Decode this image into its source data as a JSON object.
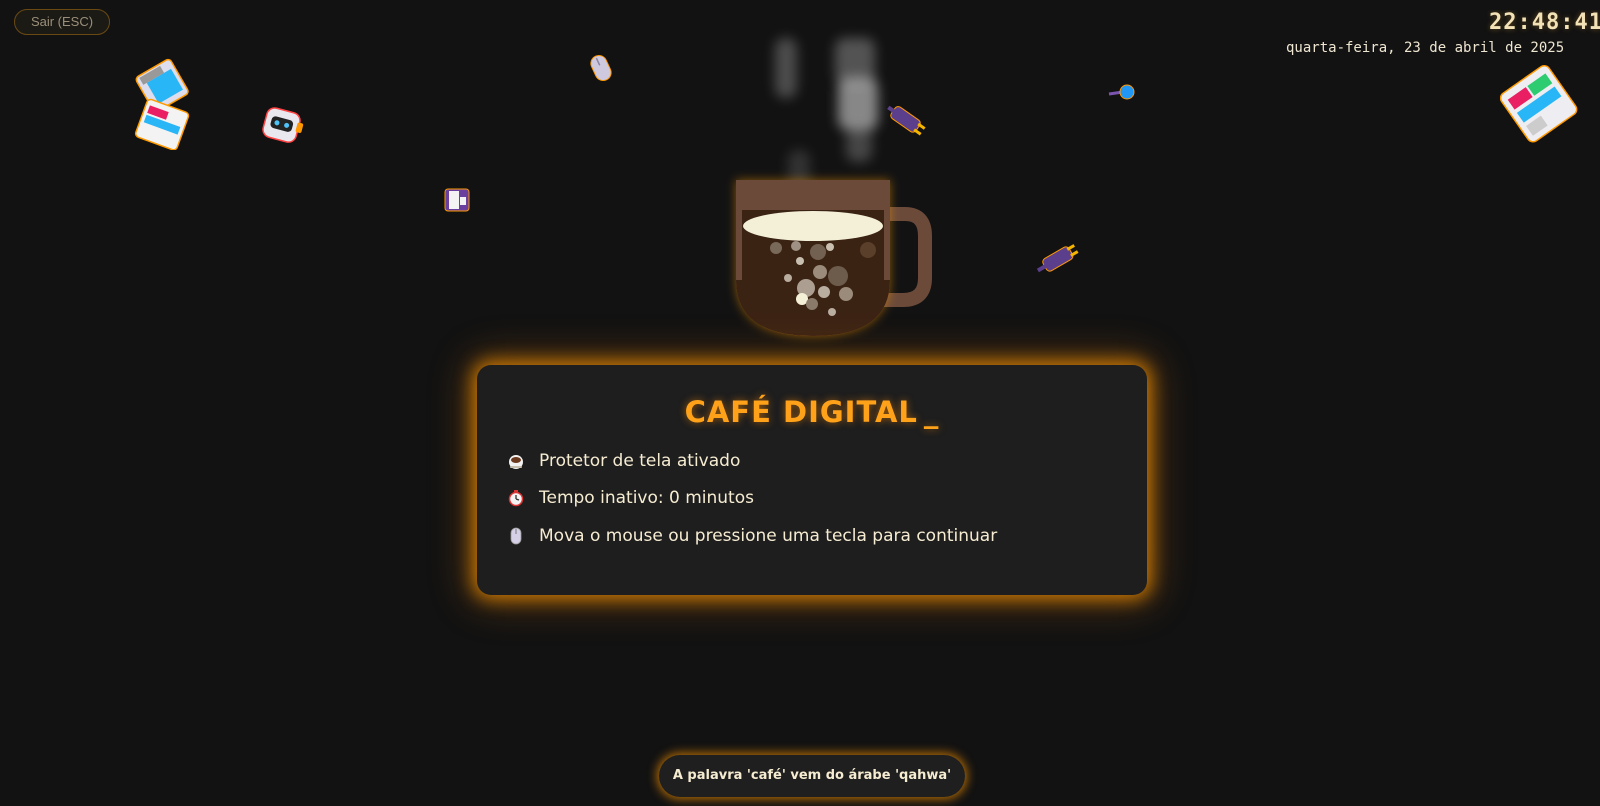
{
  "exit_button": {
    "label": "Sair (ESC)"
  },
  "clock": {
    "time": "22:48:41",
    "date": "quarta-feira, 23 de abril de 2025"
  },
  "panel": {
    "title": "CAFÉ DIGITAL",
    "cursor": "_",
    "lines": [
      {
        "icon": "coffee-icon",
        "text": "Protetor de tela ativado"
      },
      {
        "icon": "stopwatch-icon",
        "text": "Tempo inativo: 0 minutos"
      },
      {
        "icon": "mouse-icon",
        "text": "Mova o mouse ou pressione uma tecla para continuar"
      }
    ]
  },
  "fact": {
    "text": "A palavra 'café' vem do árabe 'qahwa'"
  },
  "colors": {
    "background": "#121212",
    "accent": "#ffa21a",
    "panel": "#1e1e1e",
    "cup": "#6b4a3a",
    "coffee": "#3b2314",
    "foam": "#f4f0d8"
  },
  "floating_icons": [
    "floppy-stack-icon",
    "robot-icon",
    "mouse-icon",
    "floppy-icon",
    "plug-icon",
    "pin-icon",
    "plug-icon",
    "floppy-stack-icon"
  ]
}
